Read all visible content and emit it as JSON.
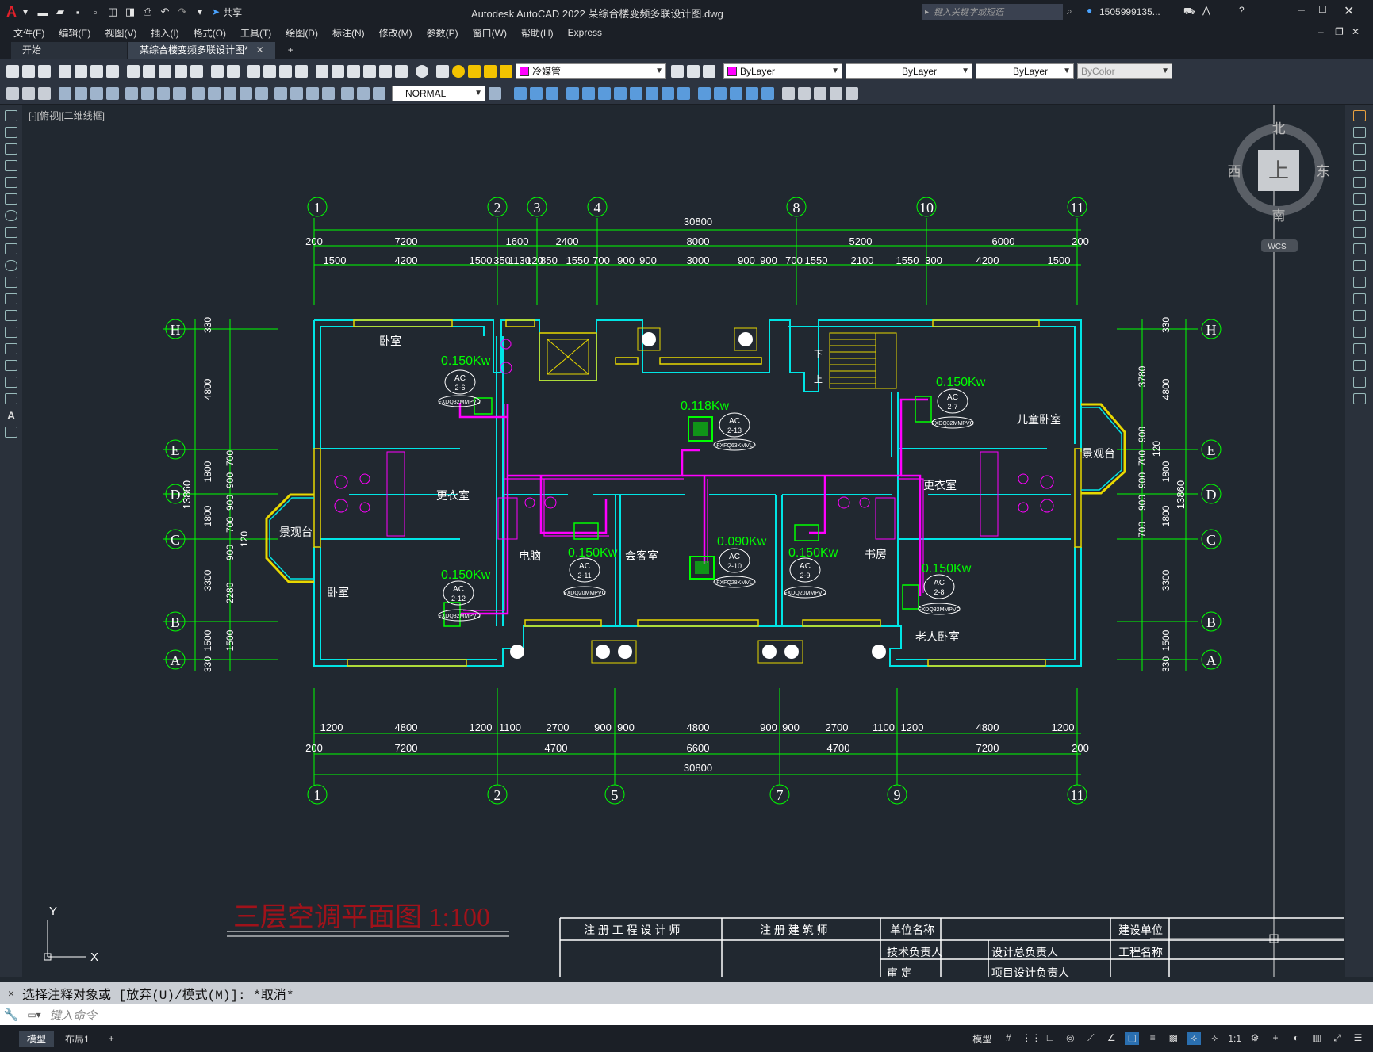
{
  "app": {
    "title": "Autodesk AutoCAD 2022    某综合楼变频多联设计图.dwg",
    "search_placeholder": "键入关键字或短语",
    "user": "1505999135..."
  },
  "quick_access": {
    "share_label": "共享"
  },
  "menu": [
    "文件(F)",
    "编辑(E)",
    "视图(V)",
    "插入(I)",
    "格式(O)",
    "工具(T)",
    "绘图(D)",
    "标注(N)",
    "修改(M)",
    "参数(P)",
    "窗口(W)",
    "帮助(H)",
    "Express"
  ],
  "tabs": [
    {
      "label": "开始",
      "active": false
    },
    {
      "label": "某综合楼变频多联设计图*",
      "active": true
    }
  ],
  "toolbar": {
    "layer": "冷媒管",
    "layer_color": "#ff00ff",
    "color": "ByLayer",
    "linetype": "ByLayer",
    "lineweight": "ByLayer",
    "plotstyle": "ByColor",
    "dimstyle": "NORMAL"
  },
  "viewport": {
    "label": "[-][俯视][二维线框]"
  },
  "viewcube": {
    "north": "北",
    "south": "南",
    "east": "东",
    "west": "西",
    "face": "上",
    "wcs": "WCS"
  },
  "drawing": {
    "title": "三层空调平面图 1:100",
    "total_width": "30800",
    "total_height": "13860",
    "top_axes": [
      "1",
      "2",
      "3",
      "4",
      "8",
      "10",
      "11"
    ],
    "bottom_axes": [
      "1",
      "2",
      "5",
      "7",
      "9",
      "11"
    ],
    "left_axes": [
      "H",
      "E",
      "D",
      "C",
      "B",
      "A"
    ],
    "right_axes": [
      "H",
      "E",
      "D",
      "C",
      "B",
      "A"
    ],
    "dims_top_row1": [
      "200",
      "7200",
      "1600",
      "2400",
      "8000",
      "5200",
      "6000",
      "200"
    ],
    "dims_top_row2": [
      "1500",
      "4200",
      "1500",
      "350",
      "1130",
      "120",
      "850",
      "1550",
      "700",
      "900",
      "900",
      "3000",
      "900",
      "900",
      "700",
      "1550",
      "2100",
      "1550",
      "300",
      "4200",
      "1500"
    ],
    "dims_bottom_row1": [
      "1200",
      "4800",
      "1200",
      "1100",
      "2700",
      "900",
      "900",
      "4800",
      "900",
      "900",
      "2700",
      "1100",
      "1200",
      "4800",
      "1200"
    ],
    "dims_bottom_row2": [
      "200",
      "7200",
      "4700",
      "6600",
      "4700",
      "7200",
      "200"
    ],
    "dims_left_outer": [
      "330",
      "4800",
      "1800",
      "1800",
      "3300",
      "1500",
      "330"
    ],
    "dims_left_inner": [
      "700",
      "900",
      "900",
      "700",
      "900",
      "120",
      "2280",
      "1500"
    ],
    "dims_right_outer": [
      "330",
      "4800",
      "1800",
      "1800",
      "3300",
      "1500",
      "330"
    ],
    "dims_right_inner": [
      "3780",
      "900",
      "120",
      "700",
      "900",
      "900",
      "700"
    ],
    "rooms": {
      "bedroom_nw": "卧室",
      "dressing_w": "更衣室",
      "balcony_w": "景观台",
      "bedroom_sw": "卧室",
      "computer": "电脑",
      "reception": "会客室",
      "study": "书房",
      "dressing_e": "更衣室",
      "child_bedroom": "儿童卧室",
      "balcony_e": "景观台",
      "elder_bedroom": "老人卧室",
      "stair_down": "下",
      "stair_up": "上"
    },
    "units": [
      {
        "kw": "0.150Kw",
        "tag": "2-6",
        "model": "FXDQ32MMPVC"
      },
      {
        "kw": "0.118Kw",
        "tag": "2-13",
        "model": "FXFQ63KMVL"
      },
      {
        "kw": "0.150Kw",
        "tag": "2-7",
        "model": "FXDQ32MMPVC"
      },
      {
        "kw": "0.150Kw",
        "tag": "2-11",
        "model": "FXDQ20MMPVC"
      },
      {
        "kw": "0.090Kw",
        "tag": "2-10",
        "model": "FXFQ28KMVL"
      },
      {
        "kw": "0.150Kw",
        "tag": "2-9",
        "model": "FXDQ20MMPVC"
      },
      {
        "kw": "0.150Kw",
        "tag": "2-12",
        "model": "FXDQ32MMPVC"
      },
      {
        "kw": "0.150Kw",
        "tag": "2-8",
        "model": "FXDQ32MMPVC"
      }
    ],
    "title_block": {
      "h1": "注 册 工 程 设 计 师",
      "h2": "注 册 建 筑 师",
      "h3": "单位名称",
      "h4": "建设单位",
      "r1": "技术负责人",
      "r2": "设计总负责人",
      "r3": "工程名称",
      "r4": "审    定",
      "r5": "项目设计负责人"
    }
  },
  "ucs": {
    "x": "X",
    "y": "Y"
  },
  "command": {
    "history": "选择注释对象或 [放弃(U)/模式(M)]: *取消*",
    "placeholder": "键入命令"
  },
  "status": {
    "layouts": [
      "模型",
      "布局1"
    ],
    "model_label": "模型",
    "scale": "1:1"
  }
}
